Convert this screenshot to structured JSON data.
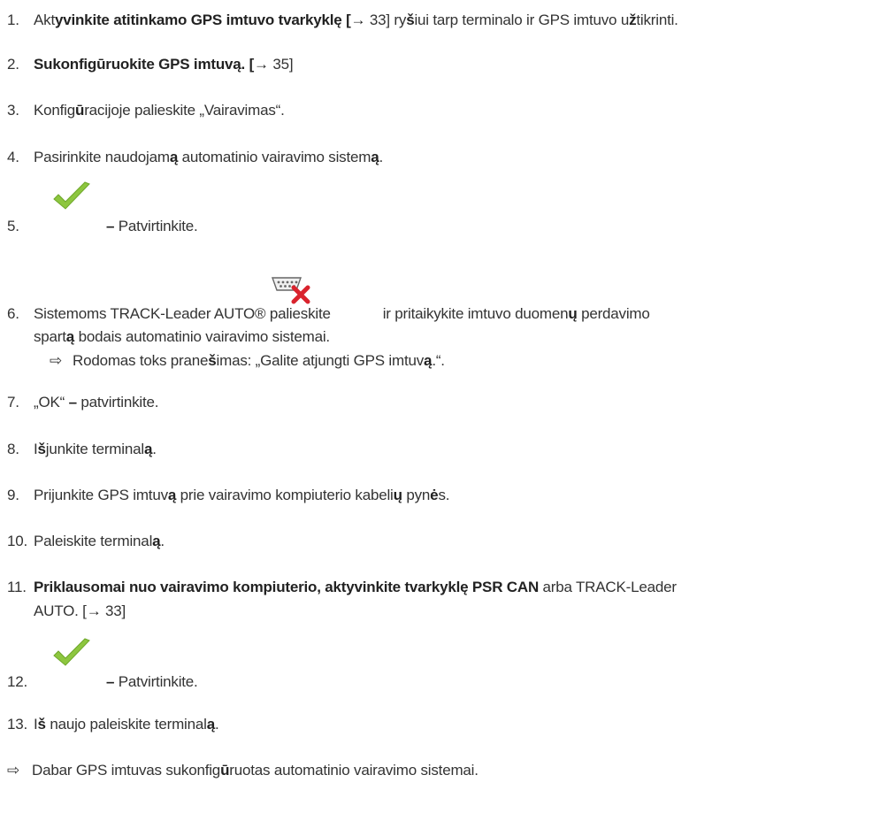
{
  "icons": {
    "check": "checkmark-icon",
    "serial_disconnect": "serial-port-disconnect-icon"
  },
  "colors": {
    "check_green": "#8dc63f",
    "cross_red": "#d9232d"
  },
  "steps": [
    {
      "num": "1.",
      "a": "Akt",
      "b": "yvinkite atitinkamo GPS imtuvo tvarkyklę [",
      "arrow": "→",
      "c": " 33] ry",
      "d": "š",
      "e": "iui tarp terminalo ir GPS imtuvo u",
      "f": "ž",
      "g": "tikrinti."
    },
    {
      "num": "2.",
      "a": "Sukonfigūruokite GPS imtuvą. [",
      "arrow": "→",
      "b": " 35]"
    },
    {
      "num": "3.",
      "a": "Konfig",
      "b": "ū",
      "c": "racijoje palieskite „Vairavimas“."
    },
    {
      "num": "4.",
      "a": "Pasirinkite naudojam",
      "b": "ą",
      "c": " automatinio vairavimo sistem",
      "d": "ą",
      "e": "."
    },
    {
      "num": "5.",
      "dash": "–",
      "text": " Patvirtinkite."
    },
    {
      "num": "6.",
      "a": "Sistemoms TRACK-Leader AUTO® palieskite",
      "b": "ir pritaikykite imtuvo duomen",
      "c": "ų",
      "d": " perdavimo",
      "line2a": "spart",
      "line2b": "ą",
      "line2c": " bodais automatinio vairavimo sistemai.",
      "sub_arrow": "⇨",
      "sub_a": "Rodomas toks prane",
      "sub_b": "š",
      "sub_c": "imas: „Galite atjungti GPS imtuv",
      "sub_d": "ą",
      "sub_e": ".“."
    },
    {
      "num": "7.",
      "a": "„OK“ ",
      "dash": "–",
      "b": " patvirtinkite."
    },
    {
      "num": "8.",
      "a": "I",
      "b": "š",
      "c": "junkite terminal",
      "d": "ą",
      "e": "."
    },
    {
      "num": "9.",
      "a": "Prijunkite GPS imtuv",
      "b": "ą",
      "c": " prie vairavimo kompiuterio kabeli",
      "d": "ų",
      "e": " pyn",
      "f": "ė",
      "g": "s."
    },
    {
      "num": "10.",
      "a": "Paleiskite terminal",
      "b": "ą",
      "c": "."
    },
    {
      "num": "11.",
      "a": "Priklausomai nuo vairavimo kompiuterio, aktyvinkite tvarkyklę PSR CAN",
      "b": " arba TRACK-Leader",
      "line2": "AUTO. [",
      "arrow": "→",
      "line2b": " 33]"
    },
    {
      "num": "12.",
      "dash": "–",
      "text": " Patvirtinkite."
    },
    {
      "num": "13.",
      "a": "I",
      "b": "š",
      "c": " naujo paleiskite terminal",
      "d": "ą",
      "e": "."
    }
  ],
  "result": {
    "arrow": "⇨",
    "a": "Dabar GPS imtuvas sukonfig",
    "b": "ū",
    "c": "ruotas automatinio vairavimo sistemai."
  }
}
